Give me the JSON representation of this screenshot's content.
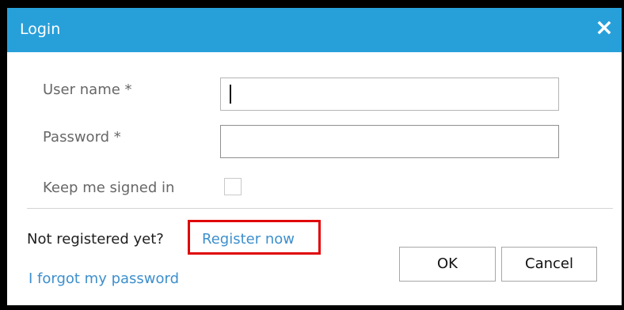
{
  "dialog": {
    "title": "Login",
    "close_icon": "close-icon"
  },
  "form": {
    "username_label": "User name *",
    "username_value": "",
    "password_label": "Password *",
    "password_value": "",
    "keep_signed_in_label": "Keep me signed in",
    "keep_signed_in_checked": false
  },
  "footer": {
    "not_registered_text": "Not registered yet?",
    "register_link": "Register now",
    "forgot_password_link": "I forgot my password",
    "ok_label": "OK",
    "cancel_label": "Cancel"
  },
  "colors": {
    "titlebar": "#27a0da",
    "link": "#3d8fcd",
    "highlight": "#e0060a"
  }
}
